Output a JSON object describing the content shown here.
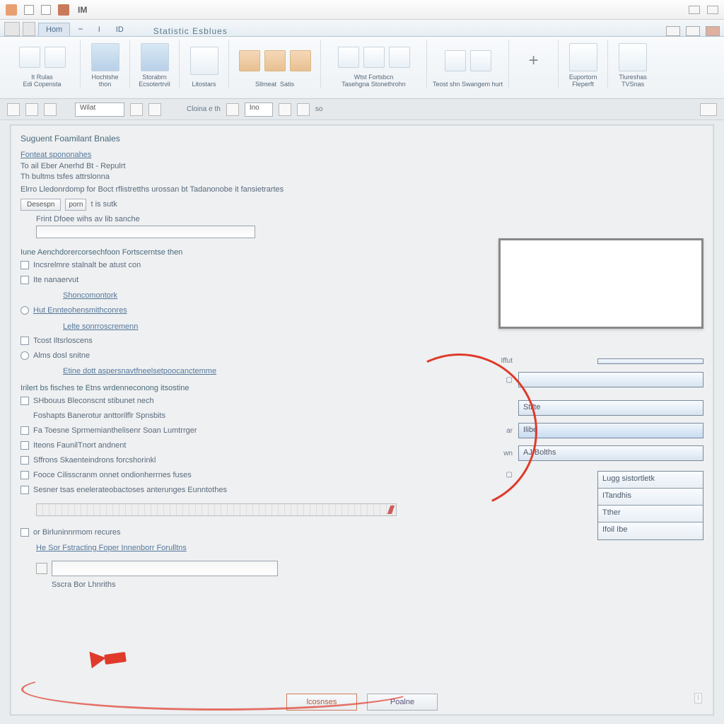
{
  "titlebar": {
    "app": "IM"
  },
  "tabs": {
    "t0": "Hom",
    "title": "Statistic Esblues"
  },
  "ribbon": {
    "g0": {
      "l1": "It Rulas",
      "l2": "Edi Copensta"
    },
    "g1": {
      "l1": "Hochtshe",
      "l2": "thon"
    },
    "g2": {
      "l1": "Storabrn",
      "l2": "Ecsotertrvil"
    },
    "g3": {
      "l1": "Litostars"
    },
    "g4": {
      "l1": "Sllmeat",
      "l2": "Satis"
    },
    "g5": {
      "l1": "Wtst  Fortsbcn",
      "l2": "Tasehgna Stonethrohn"
    },
    "g6": {
      "l1": "Teost shn",
      "l2": "Swangem hurt"
    },
    "g7": {
      "l1": "Euportorn",
      "l2": "Fleperft"
    },
    "g8": {
      "l1": "Tlureshas",
      "l2": "TVSnas"
    }
  },
  "subbar": {
    "dd": "Wilat",
    "mid": "Cloina e th",
    "tag": "Ino",
    "end": "so"
  },
  "content": {
    "title": "Suguent Foamilant Bnales",
    "link1": "Fonteat spononahes",
    "line1": "To ail Eber Anerhd Bt - Repulrt",
    "line2": "Th bultms tsfes attrslonna",
    "line3": "Elrro Lledonrdomp for Boct rflistretths urossan bt Tadanonobe it fansietrartes",
    "btn_desc": "Desespn",
    "btn_pg": "porn",
    "btn_lbl": "t is sutk",
    "label_input": "Frint Dfoee wihs av lib sanche",
    "sec2": "Iune Aenchdorercorsechfoon Fortscerntse then",
    "o1": "Incsrelmre stalnalt be atust con",
    "o2": "Ite nanaervut",
    "o3": "Shoncomontork",
    "o4": "Hut Ennteohensmithconres",
    "o5": "Lelte sonrroscremenn",
    "o6": "Tcost Iltsrloscens",
    "o7": "Alms dosl snitne",
    "o8": "Etine dott aspersnavtfneelsetpoocanctemme",
    "sec3": "Irilert bs fisches te Etns wrdenneconong itsostine",
    "p1": "SHbouus Bleconscnt stibunet nech",
    "p2": "Foshapts Banerotur anttorilflr Spnsbits",
    "p3": "Fa Toesne Sprmemianthelisenr Soan Lumtrrger",
    "p4": "Iteons FaunilTnort andnent",
    "p5": "Sffrons Skaenteindrons forcshorinkl",
    "p6": "Fooce Cilisscranm onnet ondionherrnes fuses",
    "p7": "Sesner tsas enelerateobactoses anterunges Eunntothes",
    "foot_cb": "or  Birluninnrmom recures",
    "foot_link": "He Sor Fstracting Foper Innenborr Forulltns",
    "foot_lbl": "Sscra Bor Lhnriths"
  },
  "side": {
    "f1_lbl": "Iffut",
    "f2": "Stilte",
    "f3_lbl": "ar",
    "f3": "Ilibe",
    "f4_lbl": "wn",
    "f4": "AJ Bolths",
    "s1": "Lugg sistortletk",
    "s2": "ITandhis",
    "s3": "Tther",
    "s4": "Ifoil  Ibe"
  },
  "buttons": {
    "ok": "lcosnses",
    "cancel": "Poalne"
  }
}
